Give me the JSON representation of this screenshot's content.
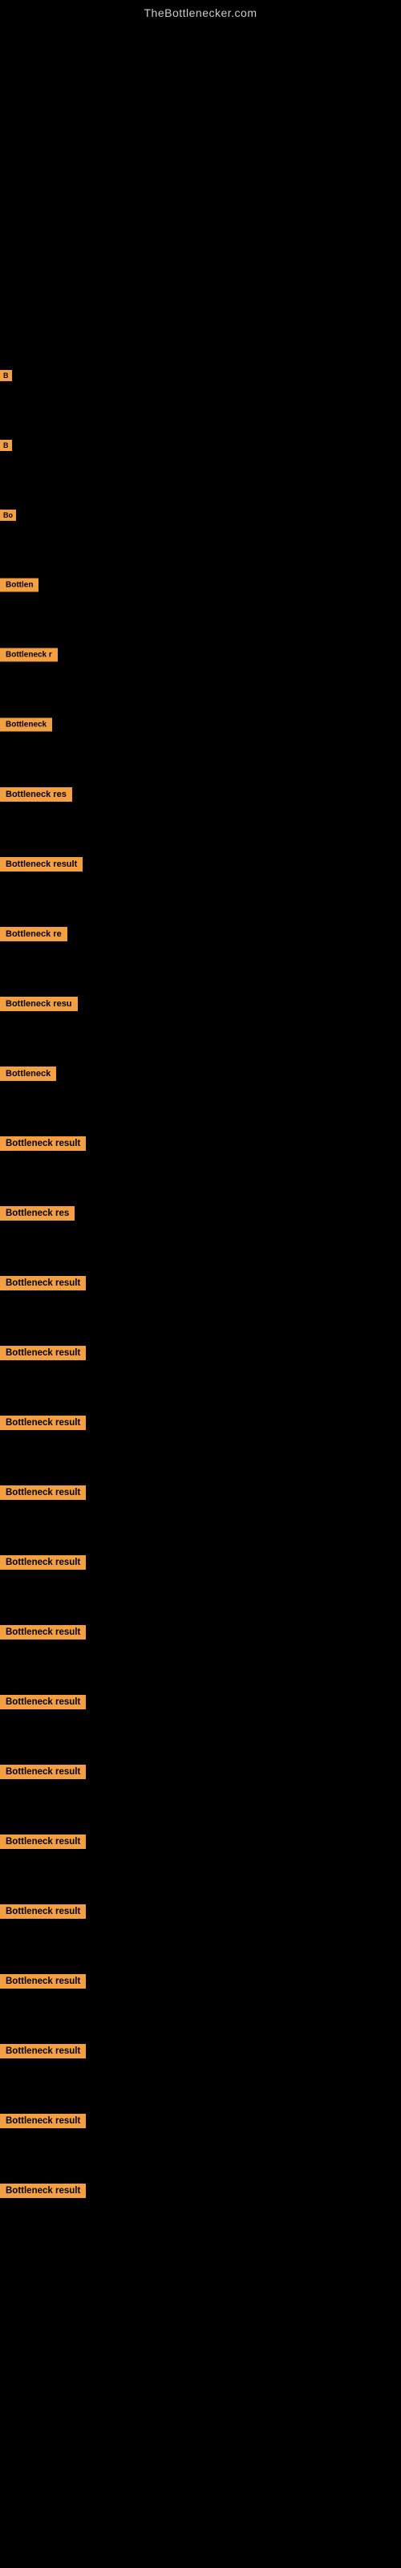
{
  "site": {
    "title": "TheBottlenecker.com"
  },
  "rows": [
    {
      "id": "r1",
      "label": "B",
      "size": "tiny"
    },
    {
      "id": "r2",
      "label": "B",
      "size": "tiny"
    },
    {
      "id": "r3",
      "label": "Bo",
      "size": "tiny"
    },
    {
      "id": "r4",
      "label": "Bottlen",
      "size": "small"
    },
    {
      "id": "r5",
      "label": "Bottleneck r",
      "size": "small"
    },
    {
      "id": "r6",
      "label": "Bottleneck",
      "size": "small"
    },
    {
      "id": "r7",
      "label": "Bottleneck res",
      "size": "medium"
    },
    {
      "id": "r8",
      "label": "Bottleneck result",
      "size": "medium"
    },
    {
      "id": "r9",
      "label": "Bottleneck re",
      "size": "medium"
    },
    {
      "id": "r10",
      "label": "Bottleneck resu",
      "size": "medium"
    },
    {
      "id": "r11",
      "label": "Bottleneck",
      "size": "medium"
    },
    {
      "id": "r12",
      "label": "Bottleneck result",
      "size": "large"
    },
    {
      "id": "r13",
      "label": "Bottleneck res",
      "size": "large"
    },
    {
      "id": "r14",
      "label": "Bottleneck result",
      "size": "large"
    },
    {
      "id": "r15",
      "label": "Bottleneck result",
      "size": "large"
    },
    {
      "id": "r16",
      "label": "Bottleneck result",
      "size": "large"
    },
    {
      "id": "r17",
      "label": "Bottleneck result",
      "size": "large"
    },
    {
      "id": "r18",
      "label": "Bottleneck result",
      "size": "large"
    },
    {
      "id": "r19",
      "label": "Bottleneck result",
      "size": "large"
    },
    {
      "id": "r20",
      "label": "Bottleneck result",
      "size": "large"
    },
    {
      "id": "r21",
      "label": "Bottleneck result",
      "size": "large"
    },
    {
      "id": "r22",
      "label": "Bottleneck result",
      "size": "large"
    },
    {
      "id": "r23",
      "label": "Bottleneck result",
      "size": "large"
    },
    {
      "id": "r24",
      "label": "Bottleneck result",
      "size": "large"
    },
    {
      "id": "r25",
      "label": "Bottleneck result",
      "size": "large"
    },
    {
      "id": "r26",
      "label": "Bottleneck result",
      "size": "large"
    },
    {
      "id": "r27",
      "label": "Bottleneck result",
      "size": "large"
    }
  ]
}
